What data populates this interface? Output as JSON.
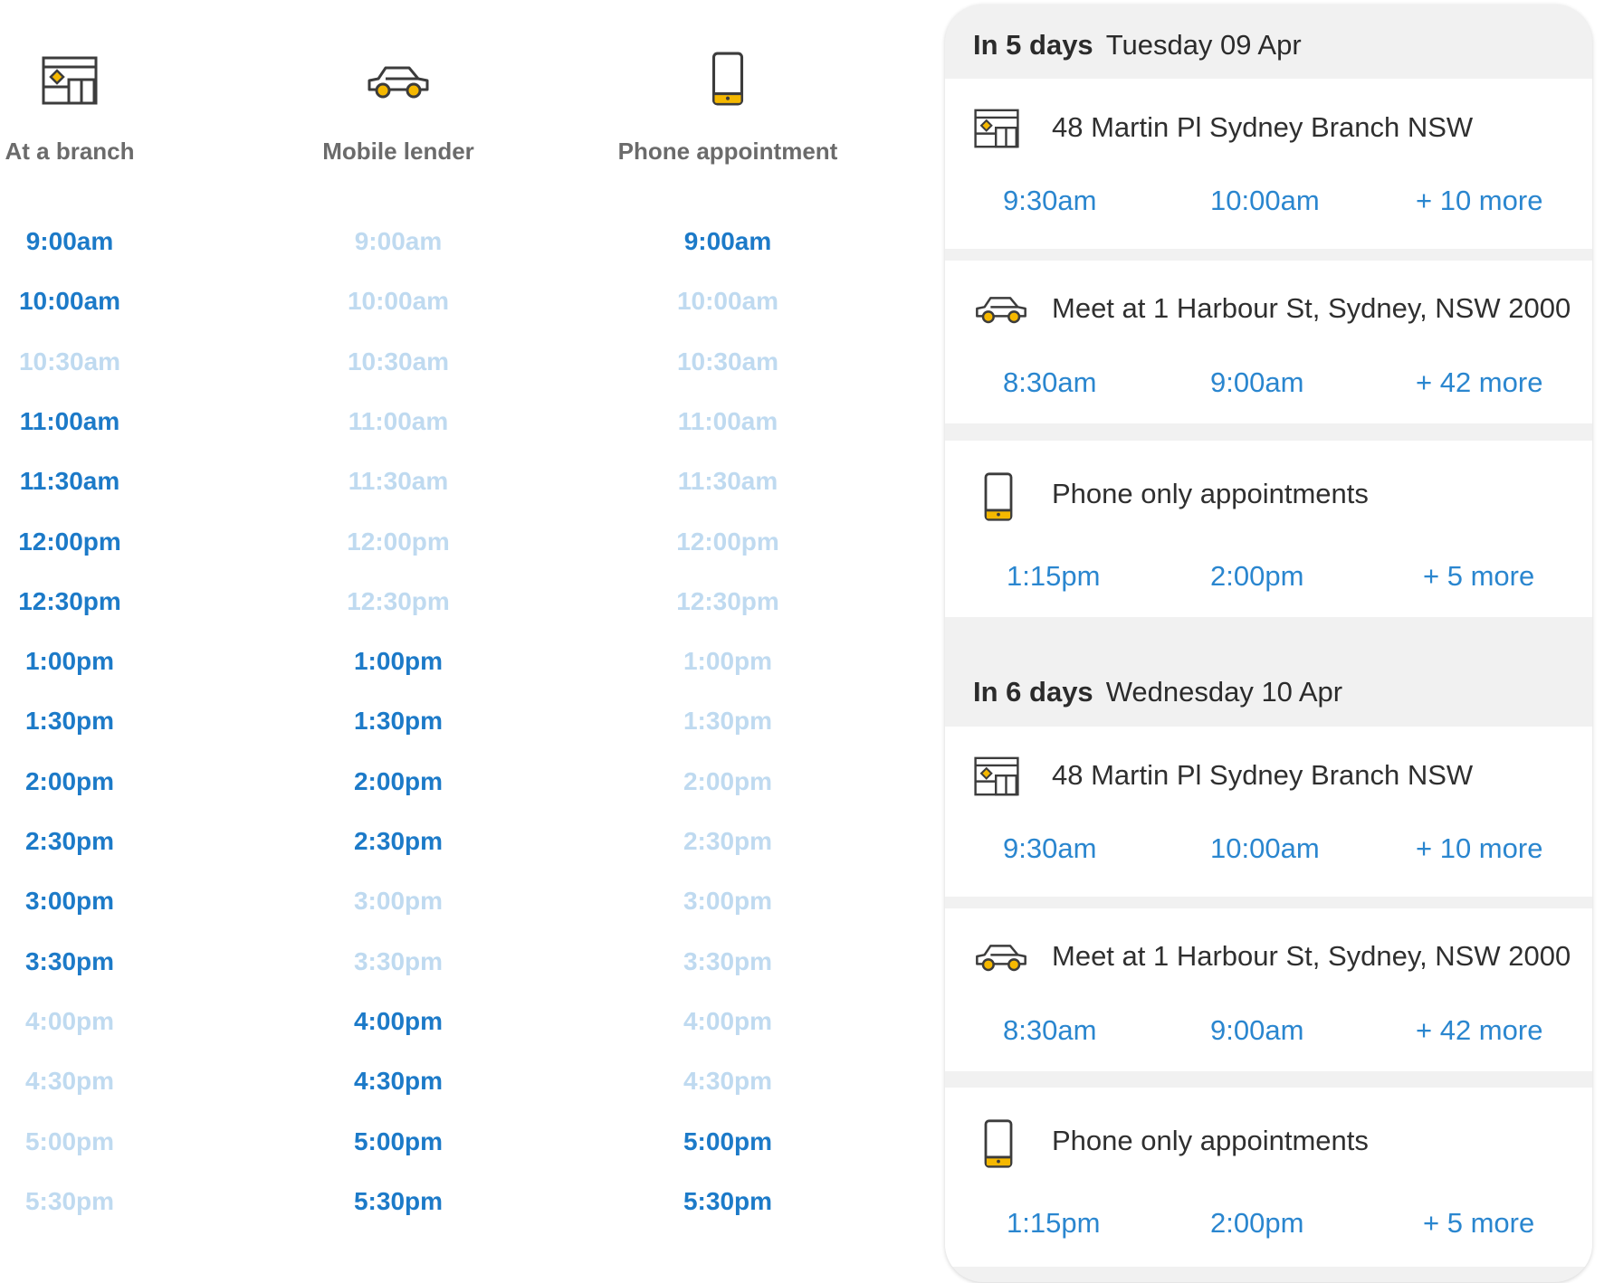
{
  "appointment_types": [
    {
      "title": "At a branch",
      "icon": "branch-icon",
      "slots": [
        {
          "time": "9:00am",
          "available": true
        },
        {
          "time": "10:00am",
          "available": true
        },
        {
          "time": "10:30am",
          "available": false
        },
        {
          "time": "11:00am",
          "available": true
        },
        {
          "time": "11:30am",
          "available": true
        },
        {
          "time": "12:00pm",
          "available": true
        },
        {
          "time": "12:30pm",
          "available": true
        },
        {
          "time": "1:00pm",
          "available": true
        },
        {
          "time": "1:30pm",
          "available": true
        },
        {
          "time": "2:00pm",
          "available": true
        },
        {
          "time": "2:30pm",
          "available": true
        },
        {
          "time": "3:00pm",
          "available": true
        },
        {
          "time": "3:30pm",
          "available": true
        },
        {
          "time": "4:00pm",
          "available": false
        },
        {
          "time": "4:30pm",
          "available": false
        },
        {
          "time": "5:00pm",
          "available": false
        },
        {
          "time": "5:30pm",
          "available": false
        }
      ]
    },
    {
      "title": "Mobile lender",
      "icon": "car-icon",
      "slots": [
        {
          "time": "9:00am",
          "available": false
        },
        {
          "time": "10:00am",
          "available": false
        },
        {
          "time": "10:30am",
          "available": false
        },
        {
          "time": "11:00am",
          "available": false
        },
        {
          "time": "11:30am",
          "available": false
        },
        {
          "time": "12:00pm",
          "available": false
        },
        {
          "time": "12:30pm",
          "available": false
        },
        {
          "time": "1:00pm",
          "available": true
        },
        {
          "time": "1:30pm",
          "available": true
        },
        {
          "time": "2:00pm",
          "available": true
        },
        {
          "time": "2:30pm",
          "available": true
        },
        {
          "time": "3:00pm",
          "available": false
        },
        {
          "time": "3:30pm",
          "available": false
        },
        {
          "time": "4:00pm",
          "available": true
        },
        {
          "time": "4:30pm",
          "available": true
        },
        {
          "time": "5:00pm",
          "available": true
        },
        {
          "time": "5:30pm",
          "available": true
        }
      ]
    },
    {
      "title": "Phone appointment",
      "icon": "phone-icon",
      "slots": [
        {
          "time": "9:00am",
          "available": true
        },
        {
          "time": "10:00am",
          "available": false
        },
        {
          "time": "10:30am",
          "available": false
        },
        {
          "time": "11:00am",
          "available": false
        },
        {
          "time": "11:30am",
          "available": false
        },
        {
          "time": "12:00pm",
          "available": false
        },
        {
          "time": "12:30pm",
          "available": false
        },
        {
          "time": "1:00pm",
          "available": false
        },
        {
          "time": "1:30pm",
          "available": false
        },
        {
          "time": "2:00pm",
          "available": false
        },
        {
          "time": "2:30pm",
          "available": false
        },
        {
          "time": "3:00pm",
          "available": false
        },
        {
          "time": "3:30pm",
          "available": false
        },
        {
          "time": "4:00pm",
          "available": false
        },
        {
          "time": "4:30pm",
          "available": false
        },
        {
          "time": "5:00pm",
          "available": true
        },
        {
          "time": "5:30pm",
          "available": true
        }
      ]
    }
  ],
  "days": [
    {
      "relative": "In 5 days",
      "date": "Tuesday 09 Apr",
      "options": [
        {
          "icon": "branch-icon",
          "title": "48 Martin Pl Sydney Branch NSW",
          "times": [
            "9:30am",
            "10:00am"
          ],
          "more": "+ 10 more"
        },
        {
          "icon": "car-icon",
          "title": "Meet at 1 Harbour St, Sydney, NSW 2000",
          "times": [
            "8:30am",
            "9:00am"
          ],
          "more": "+ 42 more"
        },
        {
          "icon": "phone-icon",
          "title": "Phone only appointments",
          "times": [
            "1:15pm",
            "2:00pm"
          ],
          "more": "+ 5 more"
        }
      ]
    },
    {
      "relative": "In 6 days",
      "date": "Wednesday 10 Apr",
      "options": [
        {
          "icon": "branch-icon",
          "title": "48 Martin Pl Sydney Branch NSW",
          "times": [
            "9:30am",
            "10:00am"
          ],
          "more": "+ 10 more"
        },
        {
          "icon": "car-icon",
          "title": "Meet at 1 Harbour St, Sydney, NSW 2000",
          "times": [
            "8:30am",
            "9:00am"
          ],
          "more": "+ 42 more"
        },
        {
          "icon": "phone-icon",
          "title": "Phone only appointments",
          "times": [
            "1:15pm",
            "2:00pm"
          ],
          "more": "+ 5 more"
        }
      ]
    }
  ],
  "colors": {
    "available": "#1c7ac8",
    "unavailable": "#bfdaf0",
    "panel_time": "#2a86cf",
    "icon_accent": "#f5b800",
    "icon_stroke": "#3c3c3c"
  }
}
